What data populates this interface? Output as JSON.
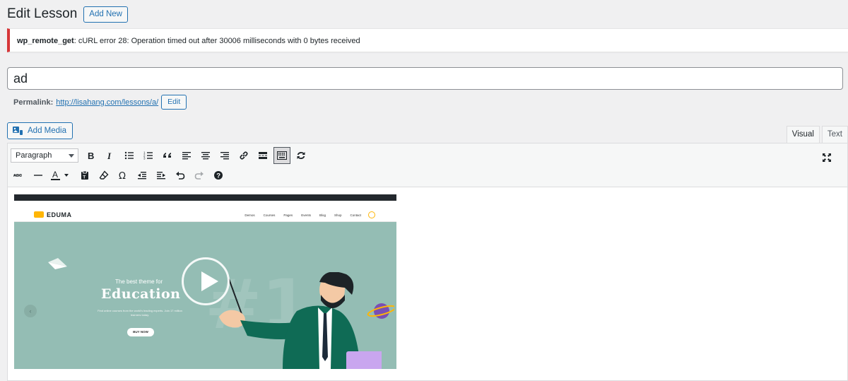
{
  "page": {
    "title": "Edit Lesson",
    "add_new_label": "Add New"
  },
  "notice": {
    "code": "wp_remote_get",
    "message": ": cURL error 28: Operation timed out after 30006 milliseconds with 0 bytes received"
  },
  "post_title": "ad",
  "permalink": {
    "label": "Permalink:",
    "url": "http://lisahang.com/lessons/a/",
    "edit_label": "Edit"
  },
  "editor": {
    "add_media_label": "Add Media",
    "tabs": [
      "Visual",
      "Text"
    ],
    "active_tab": "Visual",
    "format_select": "Paragraph",
    "toolbar_row1": [
      "bold-icon",
      "italic-icon",
      "bullet-list-icon",
      "numbered-list-icon",
      "blockquote-icon",
      "align-left-icon",
      "align-center-icon",
      "align-right-icon",
      "link-icon",
      "read-more-icon",
      "toolbar-toggle-icon",
      "refresh-icon"
    ],
    "toolbar_row2": [
      "strikethrough-icon",
      "horizontal-line-icon",
      "text-color-icon",
      "paste-text-icon",
      "clear-formatting-icon",
      "special-character-icon",
      "outdent-icon",
      "indent-icon",
      "undo-icon",
      "redo-icon",
      "help-icon"
    ]
  },
  "preview": {
    "logo": "EDUMA",
    "menu": [
      "Demos",
      "Courses",
      "Pages",
      "Events",
      "Blog",
      "Shop",
      "Contact"
    ],
    "hero_subtitle": "The best theme for",
    "hero_title": "Education",
    "hero_description": "Find online courses from the world's leading experts. Join 17 million learners today.",
    "cta": "BUY NOW",
    "background_number": "#1"
  },
  "colors": {
    "accent": "#2271b1",
    "error": "#d63638",
    "hero_bg": "#94bdb4",
    "eduma_yellow": "#ffb606"
  }
}
